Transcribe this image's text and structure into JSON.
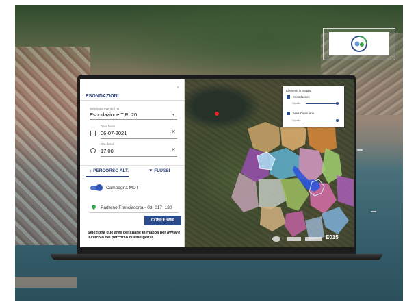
{
  "panel": {
    "title": "ESONDAZIONI",
    "close_label": "×",
    "event": {
      "label": "Seleziona evento (TR)",
      "value": "Esondazione T.R. 20"
    },
    "date": {
      "label": "Data flussi",
      "value": "06-07-2021"
    },
    "time": {
      "label": "Ora flussi",
      "value": "17:00"
    },
    "tabs": [
      {
        "icon": "↕",
        "label": "PERCORSO ALT."
      },
      {
        "icon": "▼",
        "label": "FLUSSI"
      }
    ],
    "toggle_label": "Campagna MDT",
    "location": "Paderno Franciacorta - 03_017_130",
    "confirm_label": "CONFERMA",
    "help_text": "Seleziona due aree censuarie in mappa per avviare il calcolo del percorso di emergenza"
  },
  "map": {
    "legend": {
      "title": "Elementi in mappa",
      "items": [
        {
          "label": "Esondazioni",
          "sub": "Opacità"
        },
        {
          "label": "Aree Censuarie",
          "sub": "Opacità"
        }
      ]
    },
    "footer_brand": "E015"
  },
  "colors": {
    "accent": "#2b4c8c",
    "title": "#2b3f7a",
    "marker": "#e02424",
    "flood": "#2f56d8"
  }
}
